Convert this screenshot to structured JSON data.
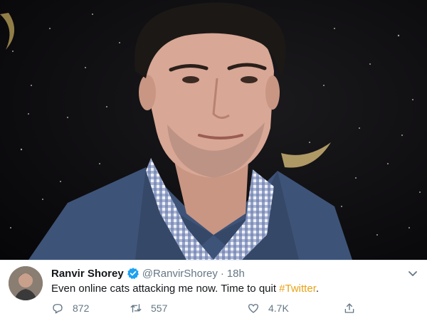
{
  "tweet": {
    "display_name": "Ranvir Shorey",
    "handle": "@RanvirShorey",
    "separator": "·",
    "time": "18h",
    "text_main": "Even online cats attacking me now. Time to quit ",
    "hashtag": "#Twitter",
    "text_end": ".",
    "reply_count": "872",
    "retweet_count": "557",
    "like_count": "4.7K"
  },
  "icons": {
    "verified": "verified-badge-icon",
    "caret": "chevron-down-icon",
    "reply": "reply-icon",
    "retweet": "retweet-icon",
    "like": "heart-icon",
    "share": "share-icon"
  },
  "colors": {
    "text_primary": "#14171a",
    "text_secondary": "#657786",
    "verified_blue": "#1da1f2",
    "hashtag": "#e8a317"
  }
}
